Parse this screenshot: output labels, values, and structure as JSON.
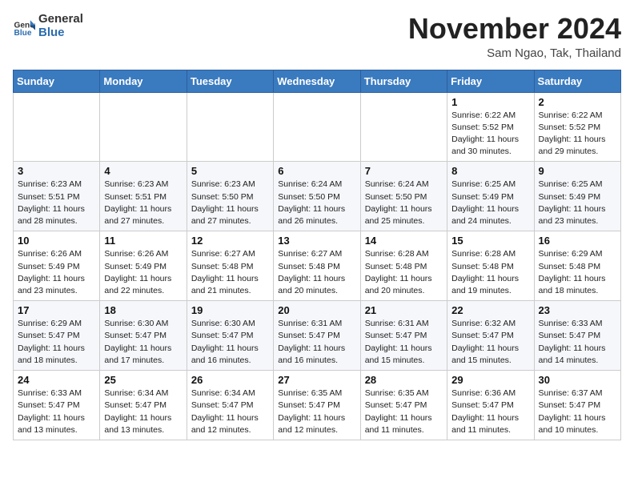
{
  "header": {
    "logo_general": "General",
    "logo_blue": "Blue",
    "month_title": "November 2024",
    "location": "Sam Ngao, Tak, Thailand"
  },
  "weekdays": [
    "Sunday",
    "Monday",
    "Tuesday",
    "Wednesday",
    "Thursday",
    "Friday",
    "Saturday"
  ],
  "weeks": [
    [
      {
        "day": "",
        "info": ""
      },
      {
        "day": "",
        "info": ""
      },
      {
        "day": "",
        "info": ""
      },
      {
        "day": "",
        "info": ""
      },
      {
        "day": "",
        "info": ""
      },
      {
        "day": "1",
        "info": "Sunrise: 6:22 AM\nSunset: 5:52 PM\nDaylight: 11 hours and 30 minutes."
      },
      {
        "day": "2",
        "info": "Sunrise: 6:22 AM\nSunset: 5:52 PM\nDaylight: 11 hours and 29 minutes."
      }
    ],
    [
      {
        "day": "3",
        "info": "Sunrise: 6:23 AM\nSunset: 5:51 PM\nDaylight: 11 hours and 28 minutes."
      },
      {
        "day": "4",
        "info": "Sunrise: 6:23 AM\nSunset: 5:51 PM\nDaylight: 11 hours and 27 minutes."
      },
      {
        "day": "5",
        "info": "Sunrise: 6:23 AM\nSunset: 5:50 PM\nDaylight: 11 hours and 27 minutes."
      },
      {
        "day": "6",
        "info": "Sunrise: 6:24 AM\nSunset: 5:50 PM\nDaylight: 11 hours and 26 minutes."
      },
      {
        "day": "7",
        "info": "Sunrise: 6:24 AM\nSunset: 5:50 PM\nDaylight: 11 hours and 25 minutes."
      },
      {
        "day": "8",
        "info": "Sunrise: 6:25 AM\nSunset: 5:49 PM\nDaylight: 11 hours and 24 minutes."
      },
      {
        "day": "9",
        "info": "Sunrise: 6:25 AM\nSunset: 5:49 PM\nDaylight: 11 hours and 23 minutes."
      }
    ],
    [
      {
        "day": "10",
        "info": "Sunrise: 6:26 AM\nSunset: 5:49 PM\nDaylight: 11 hours and 23 minutes."
      },
      {
        "day": "11",
        "info": "Sunrise: 6:26 AM\nSunset: 5:49 PM\nDaylight: 11 hours and 22 minutes."
      },
      {
        "day": "12",
        "info": "Sunrise: 6:27 AM\nSunset: 5:48 PM\nDaylight: 11 hours and 21 minutes."
      },
      {
        "day": "13",
        "info": "Sunrise: 6:27 AM\nSunset: 5:48 PM\nDaylight: 11 hours and 20 minutes."
      },
      {
        "day": "14",
        "info": "Sunrise: 6:28 AM\nSunset: 5:48 PM\nDaylight: 11 hours and 20 minutes."
      },
      {
        "day": "15",
        "info": "Sunrise: 6:28 AM\nSunset: 5:48 PM\nDaylight: 11 hours and 19 minutes."
      },
      {
        "day": "16",
        "info": "Sunrise: 6:29 AM\nSunset: 5:48 PM\nDaylight: 11 hours and 18 minutes."
      }
    ],
    [
      {
        "day": "17",
        "info": "Sunrise: 6:29 AM\nSunset: 5:47 PM\nDaylight: 11 hours and 18 minutes."
      },
      {
        "day": "18",
        "info": "Sunrise: 6:30 AM\nSunset: 5:47 PM\nDaylight: 11 hours and 17 minutes."
      },
      {
        "day": "19",
        "info": "Sunrise: 6:30 AM\nSunset: 5:47 PM\nDaylight: 11 hours and 16 minutes."
      },
      {
        "day": "20",
        "info": "Sunrise: 6:31 AM\nSunset: 5:47 PM\nDaylight: 11 hours and 16 minutes."
      },
      {
        "day": "21",
        "info": "Sunrise: 6:31 AM\nSunset: 5:47 PM\nDaylight: 11 hours and 15 minutes."
      },
      {
        "day": "22",
        "info": "Sunrise: 6:32 AM\nSunset: 5:47 PM\nDaylight: 11 hours and 15 minutes."
      },
      {
        "day": "23",
        "info": "Sunrise: 6:33 AM\nSunset: 5:47 PM\nDaylight: 11 hours and 14 minutes."
      }
    ],
    [
      {
        "day": "24",
        "info": "Sunrise: 6:33 AM\nSunset: 5:47 PM\nDaylight: 11 hours and 13 minutes."
      },
      {
        "day": "25",
        "info": "Sunrise: 6:34 AM\nSunset: 5:47 PM\nDaylight: 11 hours and 13 minutes."
      },
      {
        "day": "26",
        "info": "Sunrise: 6:34 AM\nSunset: 5:47 PM\nDaylight: 11 hours and 12 minutes."
      },
      {
        "day": "27",
        "info": "Sunrise: 6:35 AM\nSunset: 5:47 PM\nDaylight: 11 hours and 12 minutes."
      },
      {
        "day": "28",
        "info": "Sunrise: 6:35 AM\nSunset: 5:47 PM\nDaylight: 11 hours and 11 minutes."
      },
      {
        "day": "29",
        "info": "Sunrise: 6:36 AM\nSunset: 5:47 PM\nDaylight: 11 hours and 11 minutes."
      },
      {
        "day": "30",
        "info": "Sunrise: 6:37 AM\nSunset: 5:47 PM\nDaylight: 11 hours and 10 minutes."
      }
    ]
  ]
}
